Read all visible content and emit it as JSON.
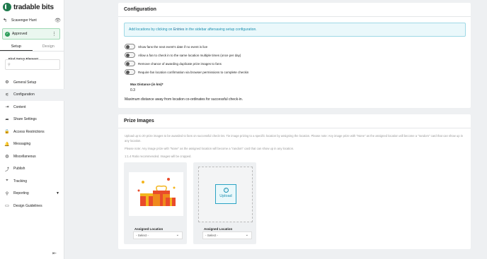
{
  "app": {
    "logo_text": "tradable bits"
  },
  "campaign": {
    "name": "Scavenger Hunt",
    "status": "Approved"
  },
  "tabs": [
    {
      "label": "Setup"
    },
    {
      "label": "Design"
    }
  ],
  "search": {
    "label": "Find Setup Element",
    "placeholder": ""
  },
  "nav": [
    {
      "label": "General Setup",
      "icon": "gear-icon"
    },
    {
      "label": "Configuration",
      "icon": "sliders-icon"
    },
    {
      "label": "Content",
      "icon": "content-icon"
    },
    {
      "label": "Share Settings",
      "icon": "share-icon"
    },
    {
      "label": "Access Restrictions",
      "icon": "lock-icon"
    },
    {
      "label": "Messaging",
      "icon": "bell-icon"
    },
    {
      "label": "Miscellaneous",
      "icon": "globe-icon"
    },
    {
      "label": "Publish",
      "icon": "publish-icon"
    },
    {
      "label": "Tracking",
      "icon": "tracking-icon"
    },
    {
      "label": "Reporting",
      "icon": "reporting-icon"
    },
    {
      "label": "Design Guidelines",
      "icon": "guidelines-icon"
    }
  ],
  "config": {
    "title": "Configuration",
    "info_pre": "Add locations by clicking on ",
    "info_link": "Entries",
    "info_post": " in the sidebar aftersaving setup configuration.",
    "toggles": [
      "Show fans the next event's date if no event is live",
      "Allow a fan to check in to the same location multiple times (once per day)",
      "Remove chance of awarding duplicate prize images to fans",
      "Require fan location confirmation via browser permissions to complete checkin"
    ],
    "max_distance_label": "Max Distance (in km)*",
    "max_distance_value": "0.3",
    "max_distance_help": "Maximum distance away from location co-ordinates for successful check-in."
  },
  "prizes": {
    "title": "Prize Images",
    "desc1": "Upload up to 20 prize images to be awarded to fans on successful check-ins. Tie image prizing to a specific location by assigning the location. Please note: Any image prize with \"None\" as the assigned location will become a \"random\" card that can show up in any location.",
    "desc2": "Please note: Any image prize with \"None\" as the assigned location will become a \"random\" card that can show up in any location.",
    "desc3": "1:1.4 Ratio recommended. Images will be cropped.",
    "upload_label": "Upload",
    "assigned_label": "Assigned Location",
    "select_value": "- Select -"
  }
}
